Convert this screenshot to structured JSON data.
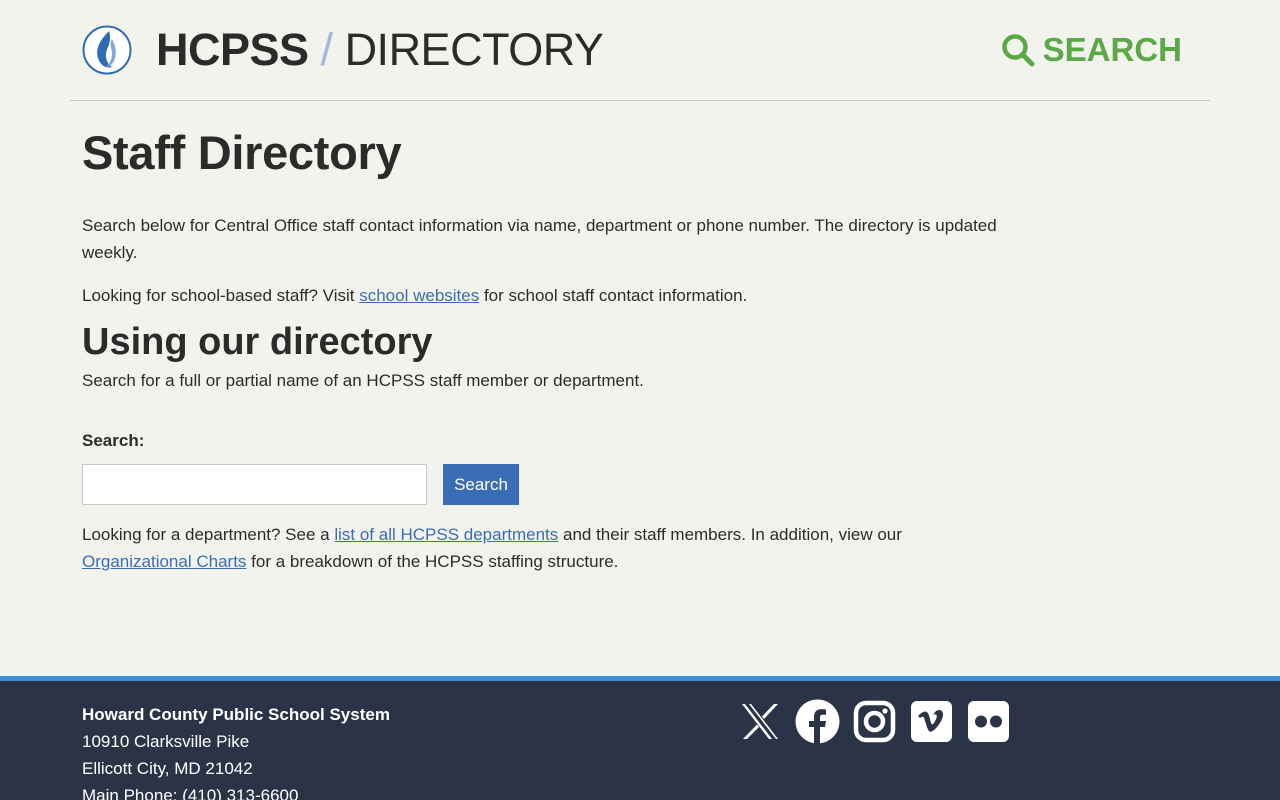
{
  "header": {
    "org": "HCPSS",
    "separator": "/",
    "section": "DIRECTORY",
    "search_label": "SEARCH"
  },
  "main": {
    "title": "Staff Directory",
    "intro": "Search below for Central Office staff contact information via name, department or phone number. The directory is updated weekly.",
    "school_prefix": "Looking for school-based staff? Visit ",
    "school_link": "school websites",
    "school_suffix": " for school staff contact information.",
    "subtitle": "Using our directory",
    "usage": "Search for a full or partial name of an HCPSS staff member or department.",
    "search_label": "Search:",
    "search_value": "",
    "search_button": "Search",
    "dept_prefix": "Looking for a department? See a ",
    "dept_link": "list of all HCPSS departments",
    "dept_middle": " and their staff members. In addition, view our ",
    "org_link": "Organizational Charts",
    "dept_suffix": " for a breakdown of the HCPSS staffing structure."
  },
  "footer": {
    "org_name": "Howard County Public School System",
    "street": "10910 Clarksville Pike",
    "city": "Ellicott City, MD 21042",
    "phone": "Main Phone: (410) 313-6600"
  },
  "social": [
    "x-icon",
    "facebook-icon",
    "instagram-icon",
    "vimeo-icon",
    "flickr-icon"
  ],
  "colors": {
    "background": "#f3f3ee",
    "accent_blue": "#3a6db6",
    "search_green": "#5aa847",
    "footer_bg": "#2b3447",
    "footer_border": "#3f8ed4"
  }
}
